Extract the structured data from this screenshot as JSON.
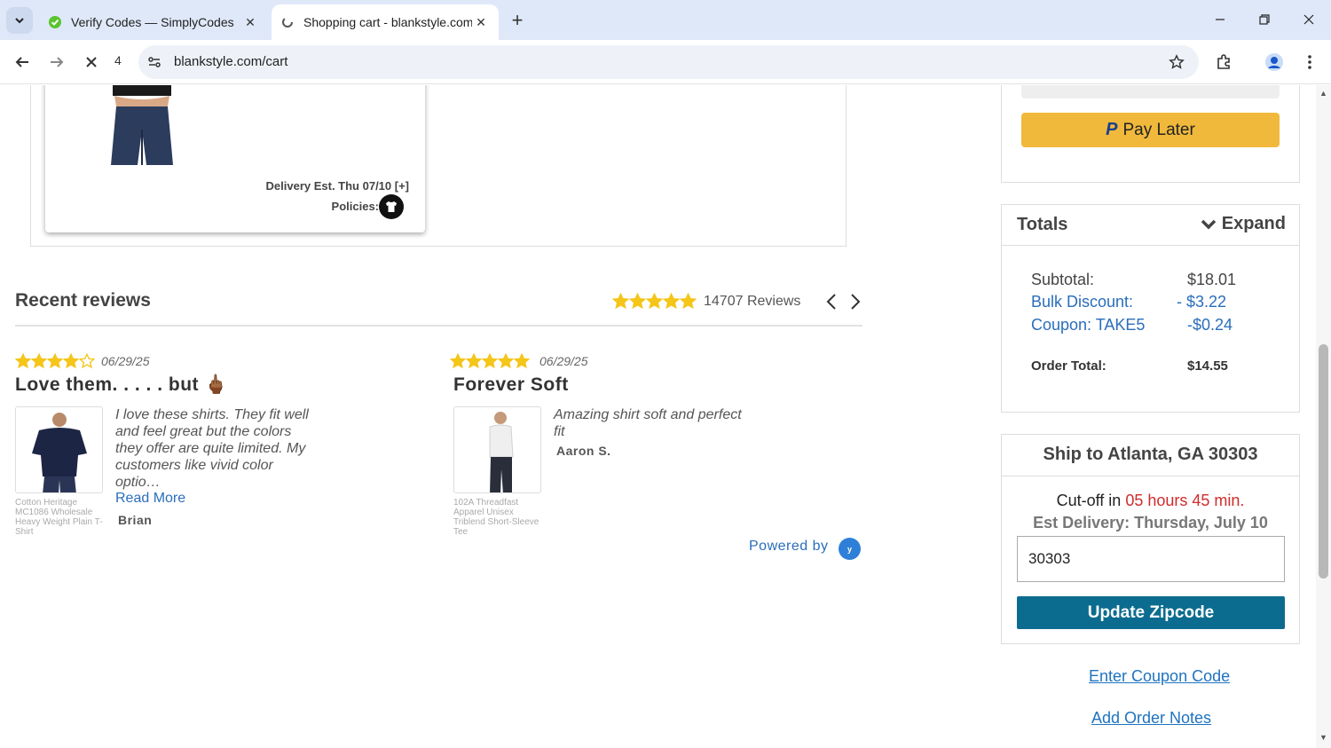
{
  "browser": {
    "tabs": [
      {
        "title": "Verify Codes — SimplyCodes",
        "active": false
      },
      {
        "title": "Shopping cart - blankstyle.com",
        "active": true
      }
    ],
    "new_tab": "+",
    "loading_count": "4",
    "url": "blankstyle.com/cart"
  },
  "cart_item": {
    "delivery_est": "Delivery Est. Thu 07/10 [+]",
    "policies_label": "Policies:"
  },
  "reviews": {
    "title": "Recent reviews",
    "count_text": "14707 Reviews",
    "summary_rating": 5,
    "items": [
      {
        "stars": 4,
        "date": "06/29/25",
        "title": "Love them. . . . . but 🖕🏾",
        "caption": "Cotton Heritage MC1086 Wholesale Heavy Weight Plain T-Shirt",
        "text": "I love these shirts. They fit well and feel great but the colors they offer are quite limited. My customers like vivid color optio…",
        "read_more": "Read More",
        "author": "Brian"
      },
      {
        "stars": 5,
        "date": "06/29/25",
        "title": "Forever Soft",
        "caption": "102A Threadfast Apparel Unisex Triblend Short-Sleeve Tee",
        "text": "Amazing shirt soft and perfect fit",
        "author": "Aaron S."
      }
    ],
    "powered_by": "Powered by",
    "powered_logo": "Yotpo"
  },
  "payment": {
    "pay_later": "Pay Later"
  },
  "totals": {
    "title": "Totals",
    "expand": "Expand",
    "subtotal_label": "Subtotal:",
    "subtotal_value": "$18.01",
    "bulk_label": "Bulk Discount:",
    "bulk_value": "- $3.22",
    "coupon_label": "Coupon: TAKE5",
    "coupon_value": "-$0.24",
    "order_total_label": "Order Total:",
    "order_total_value": "$14.55"
  },
  "shipping": {
    "title": "Ship to Atlanta, GA 30303",
    "cutoff_prefix": "Cut-off in",
    "cutoff_time": "05 hours 45 min.",
    "est_delivery": "Est Delivery: Thursday, July 10",
    "zip_value": "30303",
    "update_button": "Update Zipcode"
  },
  "links": {
    "coupon": "Enter Coupon Code",
    "notes": "Add Order Notes"
  },
  "colors": {
    "accent_teal": "#0c6c8f",
    "star_gold": "#f5c518",
    "link_blue": "#1e73c0",
    "cutoff_red": "#d02c2c",
    "paypal_gold": "#f0b93b"
  }
}
